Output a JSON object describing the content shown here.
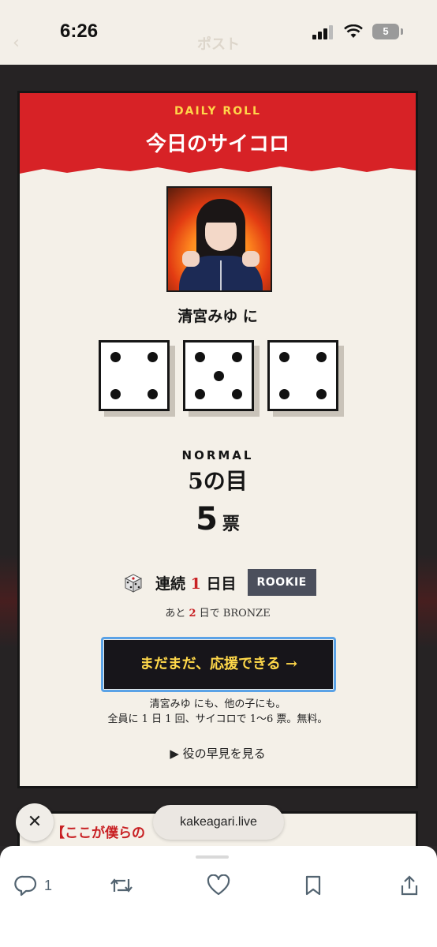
{
  "status_bar": {
    "time": "6:26",
    "battery": "5"
  },
  "nav": {
    "back_icon": "chevron-left-icon",
    "title": "ポスト"
  },
  "card": {
    "kicker": "DAILY ROLL",
    "title": "今日のサイコロ",
    "target": "清宮みゆ に",
    "dice": [
      4,
      5,
      4
    ],
    "rank": "NORMAL",
    "face_label": "5の目",
    "votes_number": "5",
    "votes_unit": "票",
    "streak_prefix": "連続",
    "streak_number": "1",
    "streak_suffix": "日目",
    "badge": "ROOKIE",
    "next_prefix": "あと",
    "next_number": "2",
    "next_suffix": "日で BRONZE",
    "cta": "まだまだ、応援できる →",
    "note_line1": "清宮みゆ にも、他の子にも。",
    "note_line2": "全員に 1 日 1 回、サイコロで 1〜6 票。無料。",
    "preview": "▶ 役の早見を見る"
  },
  "next_card": {
    "title": "【ここが僕らの"
  },
  "url_pill": "kakeagari.live",
  "close_label": "✕",
  "actions": {
    "reply_count": "1"
  },
  "colors": {
    "banner_red": "#d72226",
    "kicker_yellow": "#ffd54a",
    "cta_text": "#ffd84a",
    "badge_bg": "#4b4f5c",
    "card_bg": "#f4f0e8"
  }
}
